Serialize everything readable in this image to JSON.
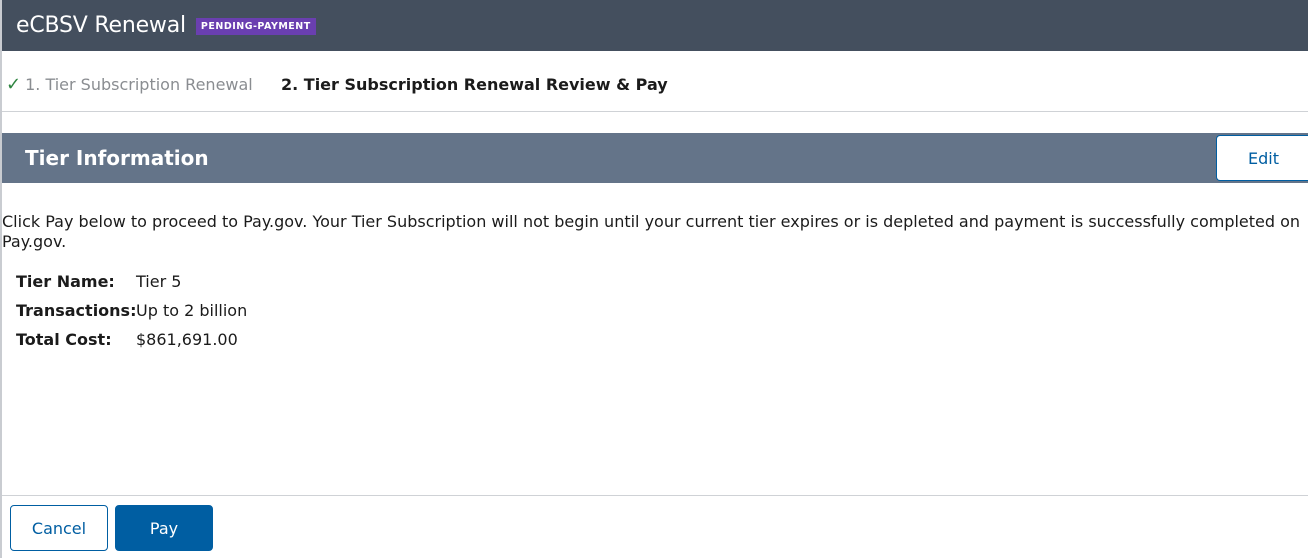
{
  "header": {
    "title": "eCBSV Renewal",
    "status_badge": "PENDING-PAYMENT"
  },
  "steps": [
    {
      "label": "1. Tier Subscription Renewal",
      "state": "complete",
      "icon": "check-icon"
    },
    {
      "label": "2. Tier Subscription Renewal Review & Pay",
      "state": "current"
    }
  ],
  "section": {
    "title": "Tier Information",
    "edit_label": "Edit"
  },
  "notice": "Click Pay below to proceed to Pay.gov. Your Tier Subscription will not begin until your current tier expires or is depleted and payment is successfully completed on Pay.gov.",
  "tier_info": [
    {
      "label": "Tier Name:",
      "value": "Tier 5"
    },
    {
      "label": "Transactions:",
      "value": "Up to 2 billion"
    },
    {
      "label": "Total Cost:",
      "value": "$861,691.00"
    }
  ],
  "footer": {
    "cancel_label": "Cancel",
    "pay_label": "Pay"
  },
  "colors": {
    "header_bg": "#444f5e",
    "badge_bg": "#6a3fb0",
    "section_bg": "#647489",
    "primary": "#005ea2",
    "success": "#2e8540"
  }
}
